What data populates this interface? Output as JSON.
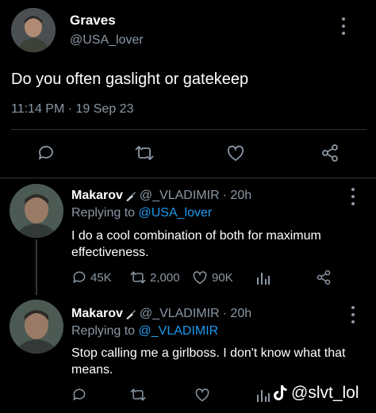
{
  "main_tweet": {
    "author_name": "Graves",
    "author_handle": "@USA_lover",
    "text": "Do you often gaslight or gatekeep",
    "timestamp": "11:14 PM · 19 Sep 23"
  },
  "replies": [
    {
      "author_name": "Makarov",
      "author_handle": "@_VLADIMIR",
      "time": "· 20h",
      "replying_prefix": "Replying to",
      "replying_to": "@USA_lover",
      "text": "I do a cool combination of both for maximum effectiveness.",
      "metrics": {
        "replies": "45K",
        "retweets": "2,000",
        "likes": "90K"
      }
    },
    {
      "author_name": "Makarov",
      "author_handle": "@_VLADIMIR",
      "time": "· 20h",
      "replying_prefix": "Replying to",
      "replying_to": "@_VLADIMIR",
      "text": "Stop calling me a girlboss. I don't know what that means."
    }
  ],
  "watermark": "@slvt_lol",
  "colors": {
    "background": "#000000",
    "text": "#e7e9ea",
    "muted": "#8b98a5",
    "link": "#1d9bf0"
  },
  "icons": [
    "reply-icon",
    "retweet-icon",
    "like-icon",
    "share-icon",
    "analytics-icon",
    "more-icon",
    "knife-icon",
    "tiktok-icon"
  ]
}
